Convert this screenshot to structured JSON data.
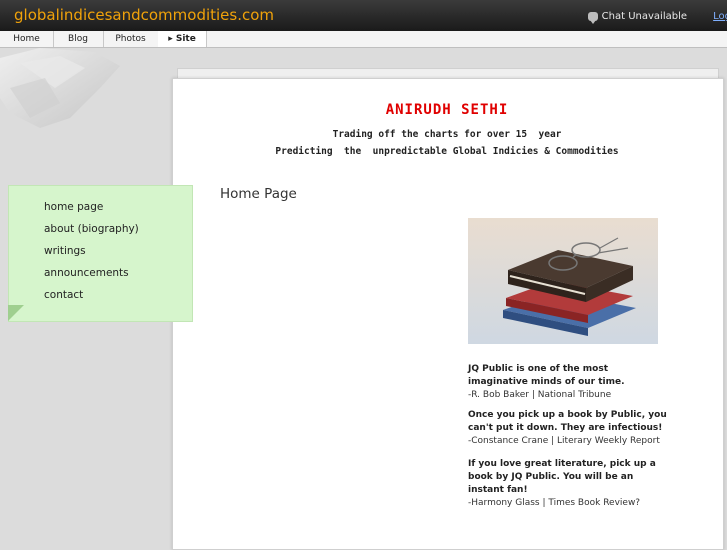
{
  "topbar": {
    "site_url": "globalindicesandcommodities.com",
    "chat_status": "Chat Unavailable",
    "login_label": "Log"
  },
  "tabs": [
    {
      "label": "Home"
    },
    {
      "label": "Blog"
    },
    {
      "label": "Photos"
    },
    {
      "label": "▸ Site",
      "active": true
    }
  ],
  "header": {
    "title": "ANIRUDH SETHI",
    "tagline1": "Trading off the charts for over 15  year",
    "tagline2": "Predicting  the  unpredictable Global Indicies & Commodities"
  },
  "main": {
    "page_heading": "Home Page"
  },
  "sidebar": {
    "items": [
      {
        "label": "home page"
      },
      {
        "label": "about (biography)"
      },
      {
        "label": "writings"
      },
      {
        "label": "announcements"
      },
      {
        "label": "contact"
      }
    ]
  },
  "quotes": [
    {
      "text": "JQ Public is one of the most imaginative minds of our time.",
      "source": "-R. Bob Baker | National Tribune"
    },
    {
      "text": "Once you pick up a book by Public, you can't put it down. They are infectious!",
      "source": "-Constance Crane | Literary Weekly Report"
    },
    {
      "text": "If you love great literature, pick up a book by JQ Public. You will be an instant fan!",
      "source": "-Harmony Glass | Times Book Review?"
    }
  ],
  "colors": {
    "site_url": "#f0a20a",
    "title": "#e00000",
    "sidebar_bg": "#d6f5cc"
  }
}
